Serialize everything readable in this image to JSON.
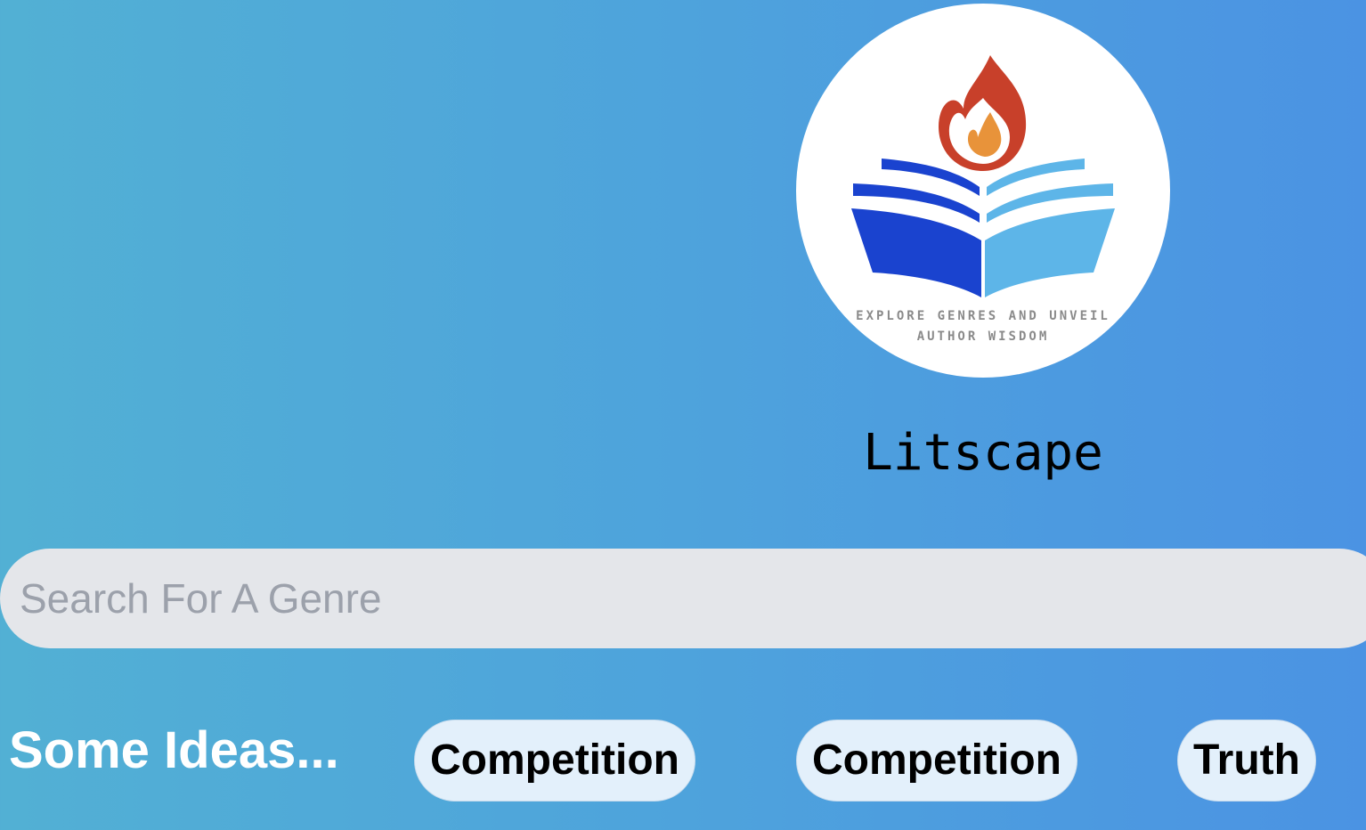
{
  "logo": {
    "icon": "book-flame-logo",
    "tagline_line1": "EXPLORE GENRES AND UNVEIL",
    "tagline_line2": "AUTHOR WISDOM",
    "colors": {
      "flame_outer": "#c8402a",
      "flame_inner": "#e8933a",
      "book_left": "#1a43cf",
      "book_right": "#5db5e8"
    }
  },
  "app": {
    "title": "Litscape"
  },
  "search": {
    "placeholder": "Search For A Genre",
    "value": ""
  },
  "ideas": {
    "label": "Some Ideas...",
    "chips": [
      {
        "label": "Competition"
      },
      {
        "label": "Competition"
      },
      {
        "label": "Truth"
      }
    ]
  },
  "colors": {
    "background_start": "#52b0d4",
    "background_end": "#4b93e3",
    "search_bg": "#e4e6ea",
    "chip_bg": "#e3f0fb",
    "ideas_label": "#ffffff"
  }
}
